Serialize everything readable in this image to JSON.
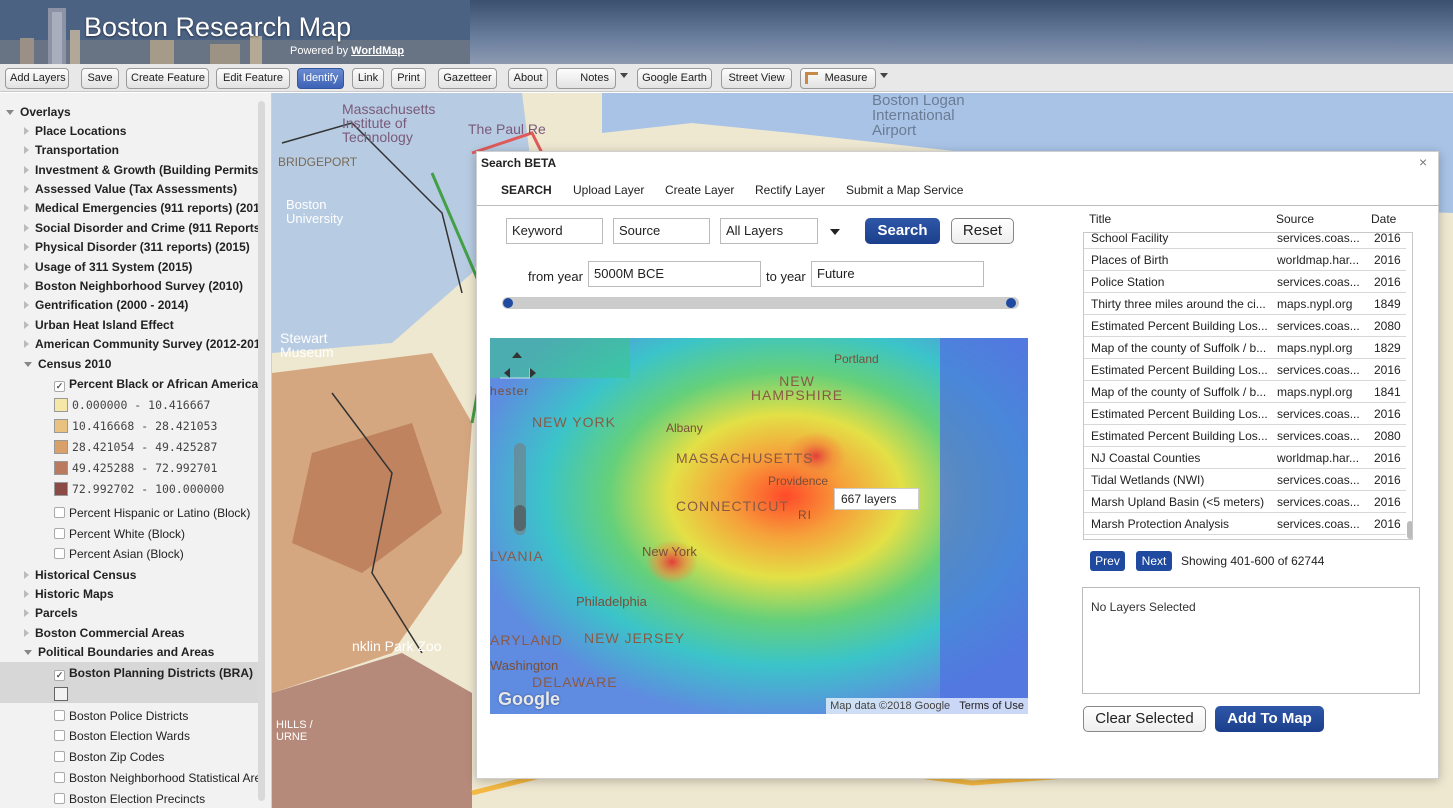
{
  "header": {
    "title": "Boston Research Map",
    "powered_prefix": "Powered by",
    "powered_link": "WorldMap"
  },
  "toolbar": {
    "add_layers": "Add Layers",
    "save": "Save",
    "create_feature": "Create Feature",
    "edit_feature": "Edit Feature",
    "identify": "Identify",
    "link": "Link",
    "print": "Print",
    "gazetteer": "Gazetteer",
    "about": "About",
    "notes": "Notes",
    "google_earth": "Google Earth",
    "street_view": "Street View",
    "measure": "Measure"
  },
  "sidebar": {
    "overlays": "Overlays",
    "groups": [
      "Place Locations",
      "Transportation",
      "Investment & Growth (Building Permits)",
      "Assessed Value (Tax Assessments)",
      "Medical Emergencies (911 reports) (201",
      "Social Disorder and Crime (911 Reports",
      "Physical Disorder (311 reports) (2015)",
      "Usage of 311 System (2015)",
      "Boston Neighborhood Survey (2010)",
      "Gentrification (2000 - 2014)",
      "Urban Heat Island Effect",
      "American Community Survey (2012-201"
    ],
    "census": "Census 2010",
    "census_layer": "Percent Black or African Americar",
    "legend": [
      {
        "label": "0.000000 - 10.416667",
        "color": "#f5e7a8"
      },
      {
        "label": "10.416668 - 28.421053",
        "color": "#e8c27e"
      },
      {
        "label": "28.421054 - 49.425287",
        "color": "#d9a06a"
      },
      {
        "label": "49.425288 - 72.992701",
        "color": "#b97a5f"
      },
      {
        "label": "72.992702 - 100.000000",
        "color": "#8c4a47"
      }
    ],
    "census_other": [
      "Percent Hispanic or Latino (Block)",
      "Percent White (Block)",
      "Percent Asian (Block)"
    ],
    "groups2": [
      "Historical Census",
      "Historic Maps",
      "Parcels",
      "Boston Commercial Areas"
    ],
    "political": "Political Boundaries and Areas",
    "planning": "Boston Planning Districts (BRA)",
    "political_layers": [
      "Boston Police Districts",
      "Boston Election Wards",
      "Boston Zip Codes",
      "Boston Neighborhood Statistical Are",
      "Boston Election Precincts"
    ]
  },
  "map_labels": {
    "mit": "Massachusetts Institute of Technology",
    "bu": "Boston University",
    "bridgeport": "BRIDGEPORT",
    "airport": "Boston Logan International Airport",
    "paul_revere": "The Paul Re",
    "stewart": "Stewart Museum",
    "zoo": "nklin Park Zoo",
    "hills": "HILLS / URNE"
  },
  "dialog": {
    "title": "Search BETA",
    "close": "×",
    "tabs": [
      "SEARCH",
      "Upload Layer",
      "Create Layer",
      "Rectify Layer",
      "Submit a Map Service"
    ],
    "keyword": "Keyword",
    "source": "Source",
    "layers_select": "All Layers",
    "search_btn": "Search",
    "reset_btn": "Reset",
    "from_year_label": "from year",
    "from_year": "5000M BCE",
    "to_year_label": "to year",
    "to_year": "Future",
    "heatmap": {
      "labels": {
        "new_york": "NEW YORK",
        "albany": "Albany",
        "new_hampshire": "NEW HAMPSHIRE",
        "portland": "Portland",
        "massachusetts": "MASSACHUSETTS",
        "providence": "Providence",
        "connecticut": "CONNECTICUT",
        "ri": "RI",
        "nyc": "New York",
        "vania": "LVANIA",
        "philadelphia": "Philadelphia",
        "maryland": "ARYLAND",
        "new_jersey": "NEW JERSEY",
        "washington": "Washington",
        "delaware": "DELAWARE",
        "chester": "hester"
      },
      "tooltip": "667 layers",
      "attribution": "Map data ©2018 Google",
      "terms": "Terms of Use",
      "google": "Google"
    },
    "results": {
      "headers": {
        "title": "Title",
        "source": "Source",
        "date": "Date"
      },
      "rows": [
        {
          "title": "School Facility",
          "source": "services.coas...",
          "date": "2016"
        },
        {
          "title": "Places of Birth",
          "source": "worldmap.har...",
          "date": "2016"
        },
        {
          "title": "Police Station",
          "source": "services.coas...",
          "date": "2016"
        },
        {
          "title": "Thirty three miles around the ci...",
          "source": "maps.nypl.org",
          "date": "1849"
        },
        {
          "title": "Estimated Percent Building Los...",
          "source": "services.coas...",
          "date": "2080"
        },
        {
          "title": "Map of the county of Suffolk / b...",
          "source": "maps.nypl.org",
          "date": "1829"
        },
        {
          "title": "Estimated Percent Building Los...",
          "source": "services.coas...",
          "date": "2016"
        },
        {
          "title": "Map of the county of Suffolk / b...",
          "source": "maps.nypl.org",
          "date": "1841"
        },
        {
          "title": "Estimated Percent Building Los...",
          "source": "services.coas...",
          "date": "2016"
        },
        {
          "title": "Estimated Percent Building Los...",
          "source": "services.coas...",
          "date": "2080"
        },
        {
          "title": "NJ Coastal Counties",
          "source": "worldmap.har...",
          "date": "2016"
        },
        {
          "title": "Tidal Wetlands (NWI)",
          "source": "services.coas...",
          "date": "2016"
        },
        {
          "title": "Marsh Upland Basin (<5 meters)",
          "source": "services.coas...",
          "date": "2016"
        },
        {
          "title": "Marsh Protection Analysis",
          "source": "services.coas...",
          "date": "2016"
        }
      ]
    },
    "prev": "Prev",
    "next": "Next",
    "showing": "Showing 401-600 of 62744",
    "no_selected": "No Layers Selected",
    "clear_selected": "Clear Selected",
    "add_to_map": "Add To Map"
  }
}
